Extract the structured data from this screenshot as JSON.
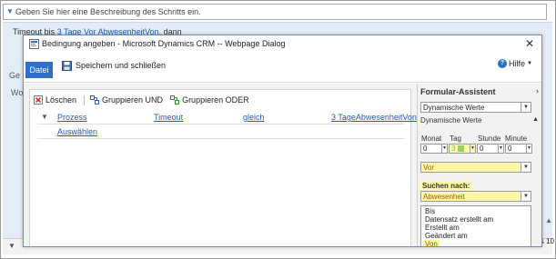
{
  "background": {
    "step_description_placeholder": "Geben Sie hier eine Beschreibung des Schritts ein.",
    "timeout_prefix": "Timeout bis",
    "timeout_link": "3 Tage Vor AbwesenheitVon",
    "timeout_suffix": ", dann",
    "side_label_a": "Ge",
    "side_label_b": "Wo",
    "zoom_text": "10"
  },
  "dialog": {
    "title": "Bedingung angeben - Microsoft Dynamics CRM -- Webpage Dialog",
    "close_label": "✕"
  },
  "ribbon": {
    "file_tab": "Datei",
    "save_close": "Speichern und schließen",
    "help": "Hilfe"
  },
  "toolbar": {
    "delete": "Löschen",
    "group_and": "Gruppieren UND",
    "group_or": "Gruppieren ODER"
  },
  "condition": {
    "entity": "Prozess",
    "field": "Timeout",
    "operator": "gleich",
    "value": "3 TageAbwesenheitVon",
    "select_link": "Auswählen"
  },
  "assistant": {
    "title": "Formular-Assistent",
    "source_select": "Dynamische Werte",
    "dynamic_header": "Dynamische Werte",
    "labels": {
      "month": "Monat",
      "day": "Tag",
      "hour": "Stunde",
      "minute": "Minute"
    },
    "values": {
      "month": "0",
      "day": "3",
      "hour": "0",
      "minute": "0"
    },
    "direction_select": "Vor",
    "search_label": "Suchen nach:",
    "search_select": "Abwesenheit",
    "list_items": [
      "Bis",
      "Datensatz erstellt am",
      "Erstellt am",
      "Geändert am",
      "Von"
    ],
    "highlight_color": "#fff9a8",
    "day_fill_color": "#9bd15a"
  }
}
